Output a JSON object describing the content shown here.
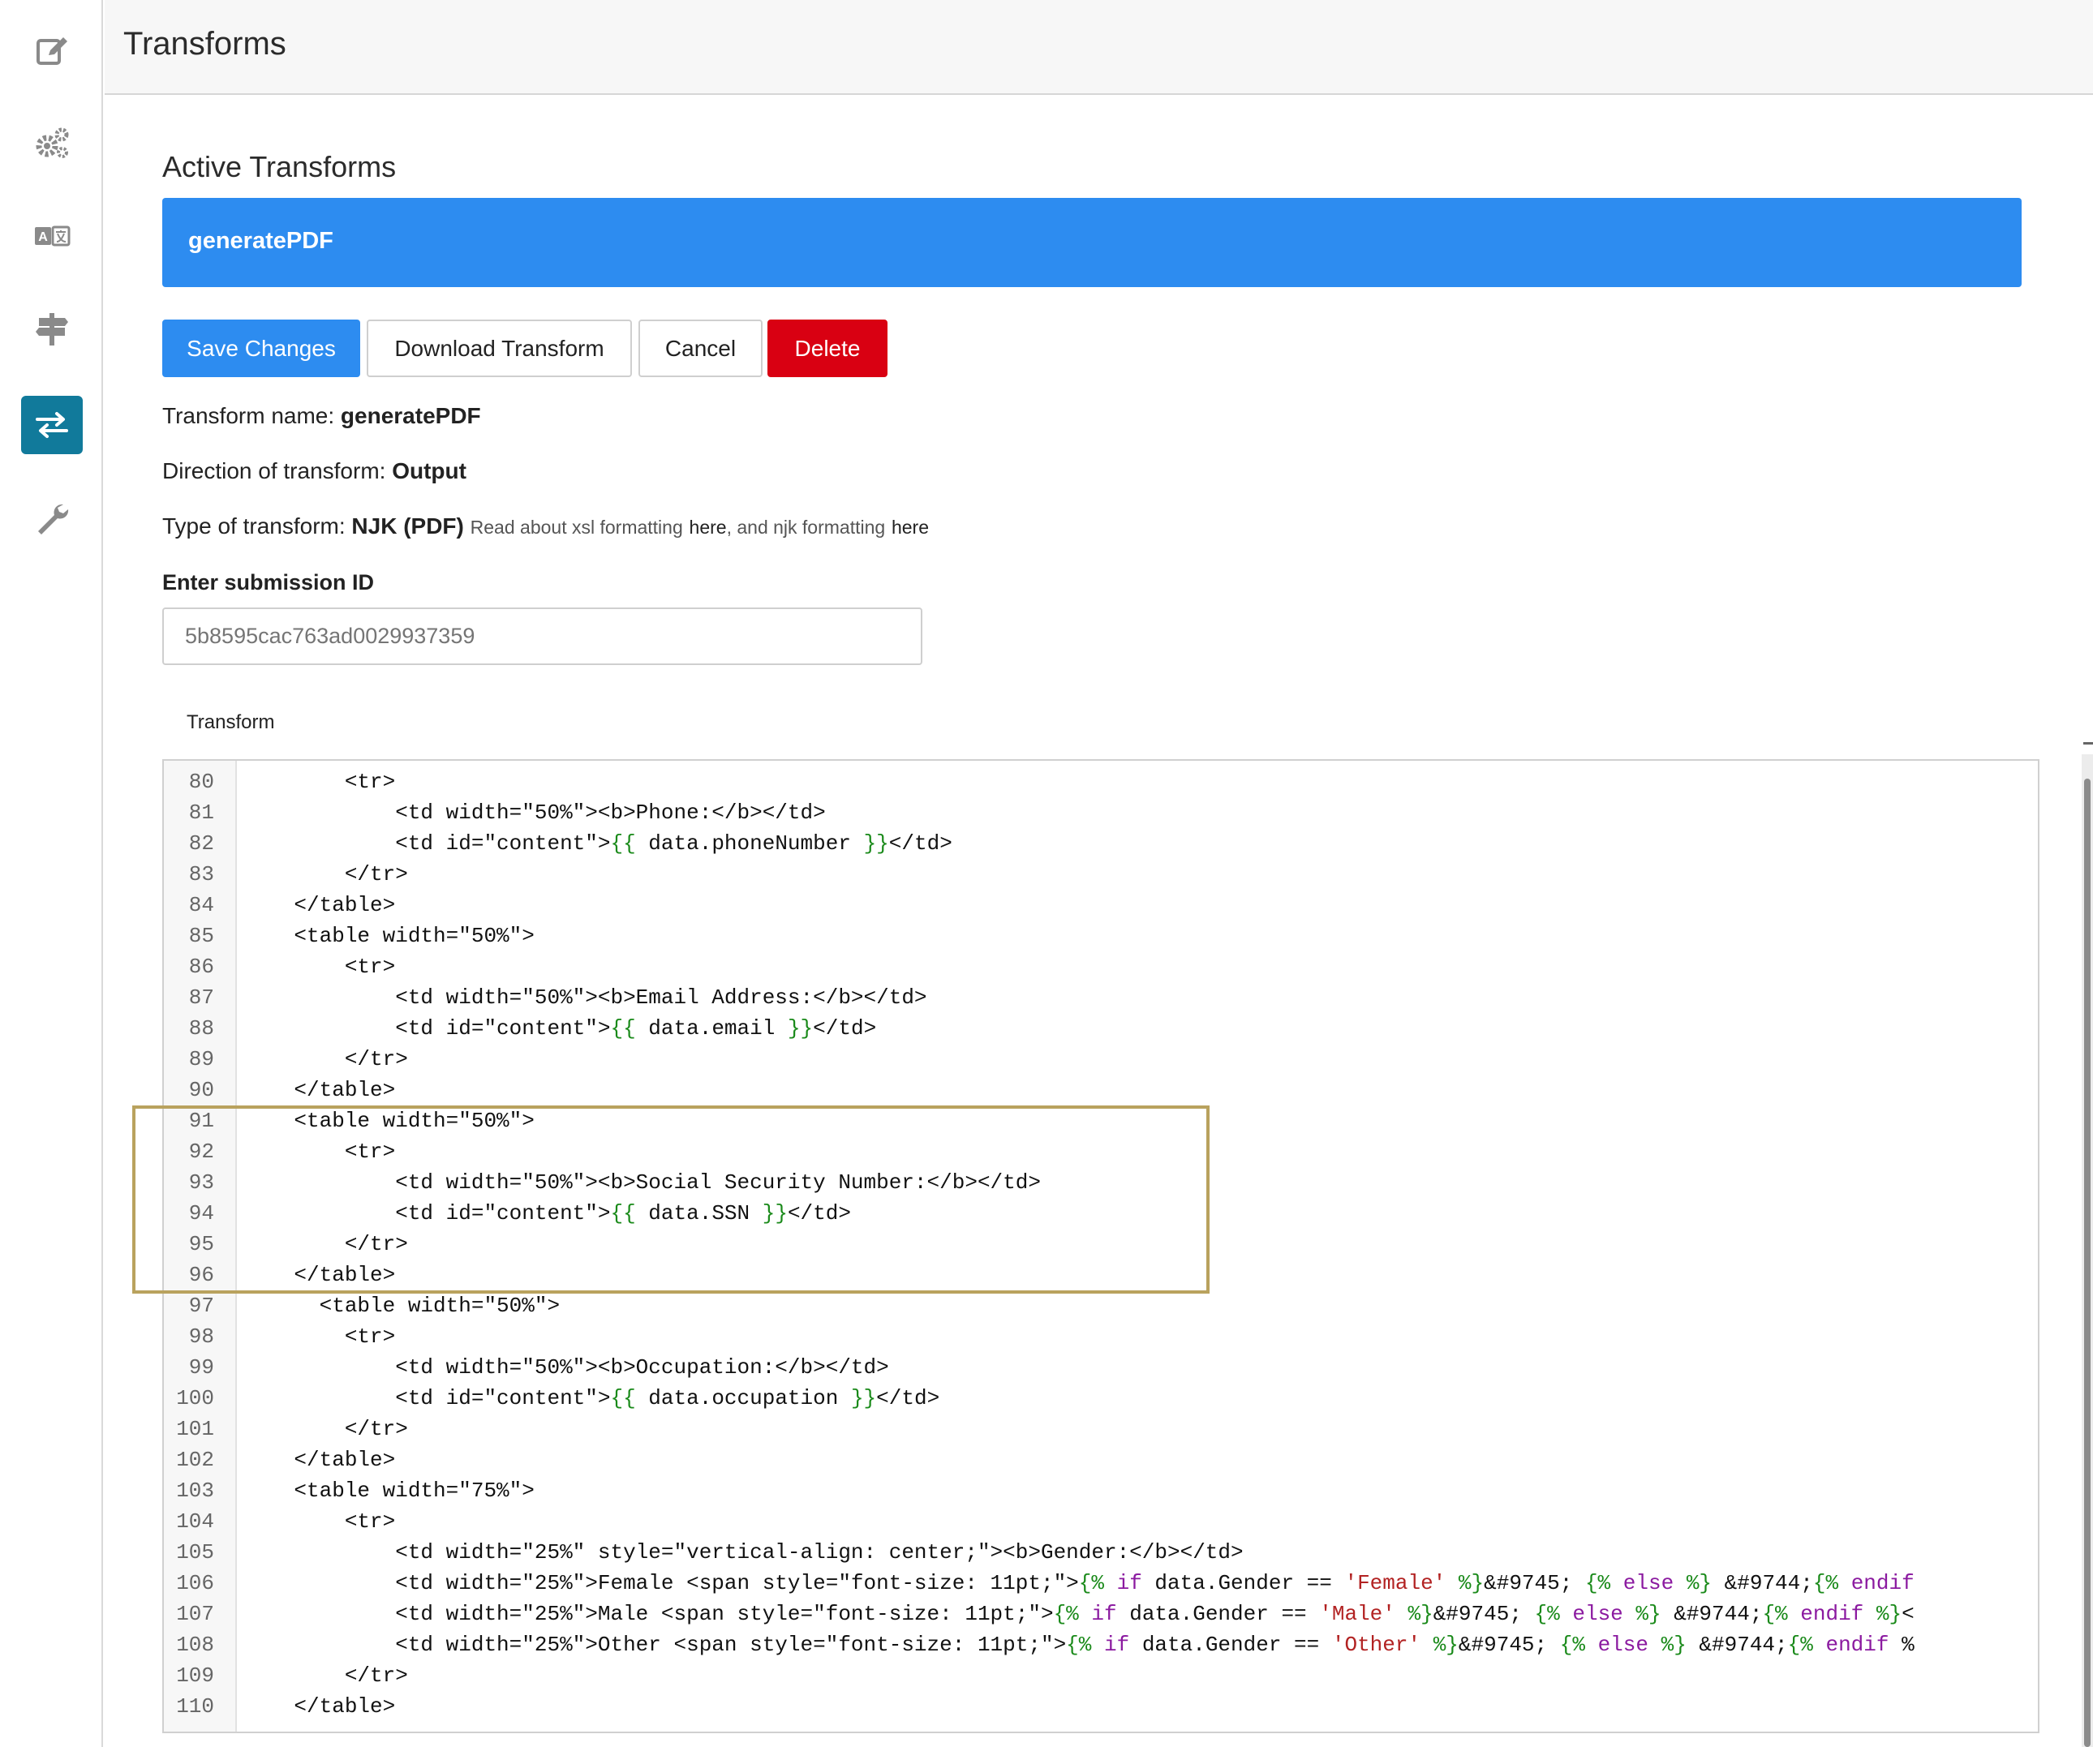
{
  "sidebar": {
    "items": [
      {
        "icon": "edit-icon"
      },
      {
        "icon": "gears-icon"
      },
      {
        "icon": "translate-icon"
      },
      {
        "icon": "signpost-icon"
      },
      {
        "icon": "transfer-arrows-icon",
        "active": true
      },
      {
        "icon": "wrench-icon"
      }
    ],
    "active_color": "#117a9b"
  },
  "header": {
    "title": "Transforms"
  },
  "main": {
    "section_title": "Active Transforms",
    "active_transform": "generatePDF",
    "buttons": {
      "save": "Save Changes",
      "download": "Download Transform",
      "cancel": "Cancel",
      "delete": "Delete"
    },
    "name_label": "Transform name:",
    "name_value": "generatePDF",
    "direction_label": "Direction of transform:",
    "direction_value": "Output",
    "type_label": "Type of transform:",
    "type_value": "NJK (PDF)",
    "type_note_1": "Read about xsl formatting",
    "link_1": "here",
    "type_note_2": ", and njk formatting",
    "link_2": "here",
    "submission_label": "Enter submission ID",
    "submission_placeholder": "5b8595cac763ad0029937359",
    "transform_label": "Transform"
  },
  "colors": {
    "primary": "#2d8cf0",
    "danger": "#d90012",
    "highlight_border": "#b9a25e"
  },
  "code": {
    "highlighted_lines": [
      91,
      96
    ],
    "lines": [
      {
        "n": "80",
        "t": "        <tr>"
      },
      {
        "n": "81",
        "t": "            <td width=\"50%\"><b>Phone:</b></td>"
      },
      {
        "n": "82",
        "t": "            <td id=\"content\">{{ data.phoneNumber }}</td>"
      },
      {
        "n": "83",
        "t": "        </tr>"
      },
      {
        "n": "84",
        "t": "    </table>"
      },
      {
        "n": "85",
        "t": "    <table width=\"50%\">"
      },
      {
        "n": "86",
        "t": "        <tr>"
      },
      {
        "n": "87",
        "t": "            <td width=\"50%\"><b>Email Address:</b></td>"
      },
      {
        "n": "88",
        "t": "            <td id=\"content\">{{ data.email }}</td>"
      },
      {
        "n": "89",
        "t": "        </tr>"
      },
      {
        "n": "90",
        "t": "    </table>"
      },
      {
        "n": "91",
        "t": "    <table width=\"50%\">"
      },
      {
        "n": "92",
        "t": "        <tr>"
      },
      {
        "n": "93",
        "t": "            <td width=\"50%\"><b>Social Security Number:</b></td>"
      },
      {
        "n": "94",
        "t": "            <td id=\"content\">{{ data.SSN }}</td>"
      },
      {
        "n": "95",
        "t": "        </tr>"
      },
      {
        "n": "96",
        "t": "    </table>"
      },
      {
        "n": "97",
        "t": "      <table width=\"50%\">"
      },
      {
        "n": "98",
        "t": "        <tr>"
      },
      {
        "n": "99",
        "t": "            <td width=\"50%\"><b>Occupation:</b></td>"
      },
      {
        "n": "100",
        "t": "            <td id=\"content\">{{ data.occupation }}</td>"
      },
      {
        "n": "101",
        "t": "        </tr>"
      },
      {
        "n": "102",
        "t": "    </table>"
      },
      {
        "n": "103",
        "t": "    <table width=\"75%\">"
      },
      {
        "n": "104",
        "t": "        <tr>"
      },
      {
        "n": "105",
        "t": "            <td width=\"25%\" style=\"vertical-align: center;\"><b>Gender:</b></td>"
      },
      {
        "n": "106",
        "t": "            <td width=\"25%\">Female <span style=\"font-size: 11pt;\">{% if data.Gender == 'Female' %}&#9745; {% else %} &#9744;{% endif"
      },
      {
        "n": "107",
        "t": "            <td width=\"25%\">Male <span style=\"font-size: 11pt;\">{% if data.Gender == 'Male' %}&#9745; {% else %} &#9744;{% endif %}<"
      },
      {
        "n": "108",
        "t": "            <td width=\"25%\">Other <span style=\"font-size: 11pt;\">{% if data.Gender == 'Other' %}&#9745; {% else %} &#9744;{% endif %"
      },
      {
        "n": "109",
        "t": "        </tr>"
      },
      {
        "n": "110",
        "t": "    </table>"
      }
    ]
  }
}
